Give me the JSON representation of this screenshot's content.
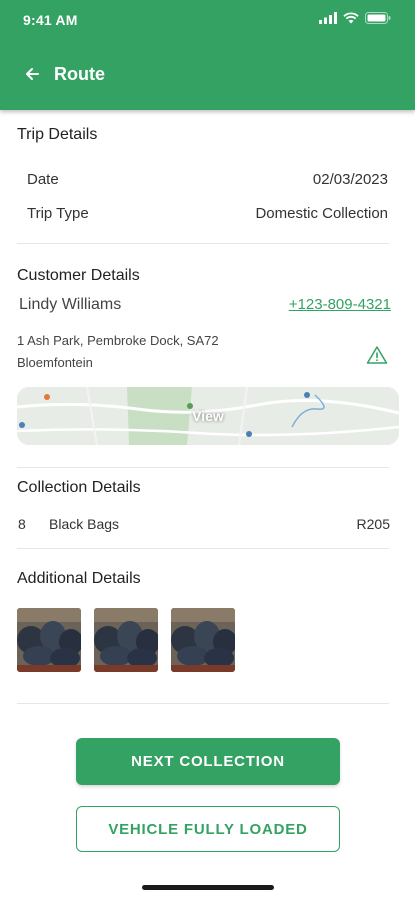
{
  "status_bar": {
    "time": "9:41 AM"
  },
  "header": {
    "title": "Route",
    "back_icon": "arrow-left-icon"
  },
  "trip_details": {
    "title": "Trip Details",
    "date_label": "Date",
    "date_value": "02/03/2023",
    "type_label": "Trip Type",
    "type_value": "Domestic Collection"
  },
  "customer_details": {
    "title": "Customer Details",
    "name": "Lindy Williams",
    "phone": "+123-809-4321",
    "address_line1": "1 Ash Park, Pembroke Dock, SA72",
    "address_line2": "Bloemfontein",
    "warning_icon": "warning-icon",
    "map_label": "View"
  },
  "collection_details": {
    "title": "Collection Details",
    "quantity": "8",
    "item": "Black Bags",
    "price": "R205"
  },
  "additional_details": {
    "title": "Additional Details",
    "photos": [
      "garbage-bags-photo",
      "garbage-bags-photo",
      "garbage-bags-photo"
    ]
  },
  "actions": {
    "primary": "NEXT COLLECTION",
    "secondary": "VEHICLE FULLY LOADED"
  },
  "colors": {
    "brand": "#34a263",
    "text": "#222222",
    "warning": "#34a263"
  }
}
